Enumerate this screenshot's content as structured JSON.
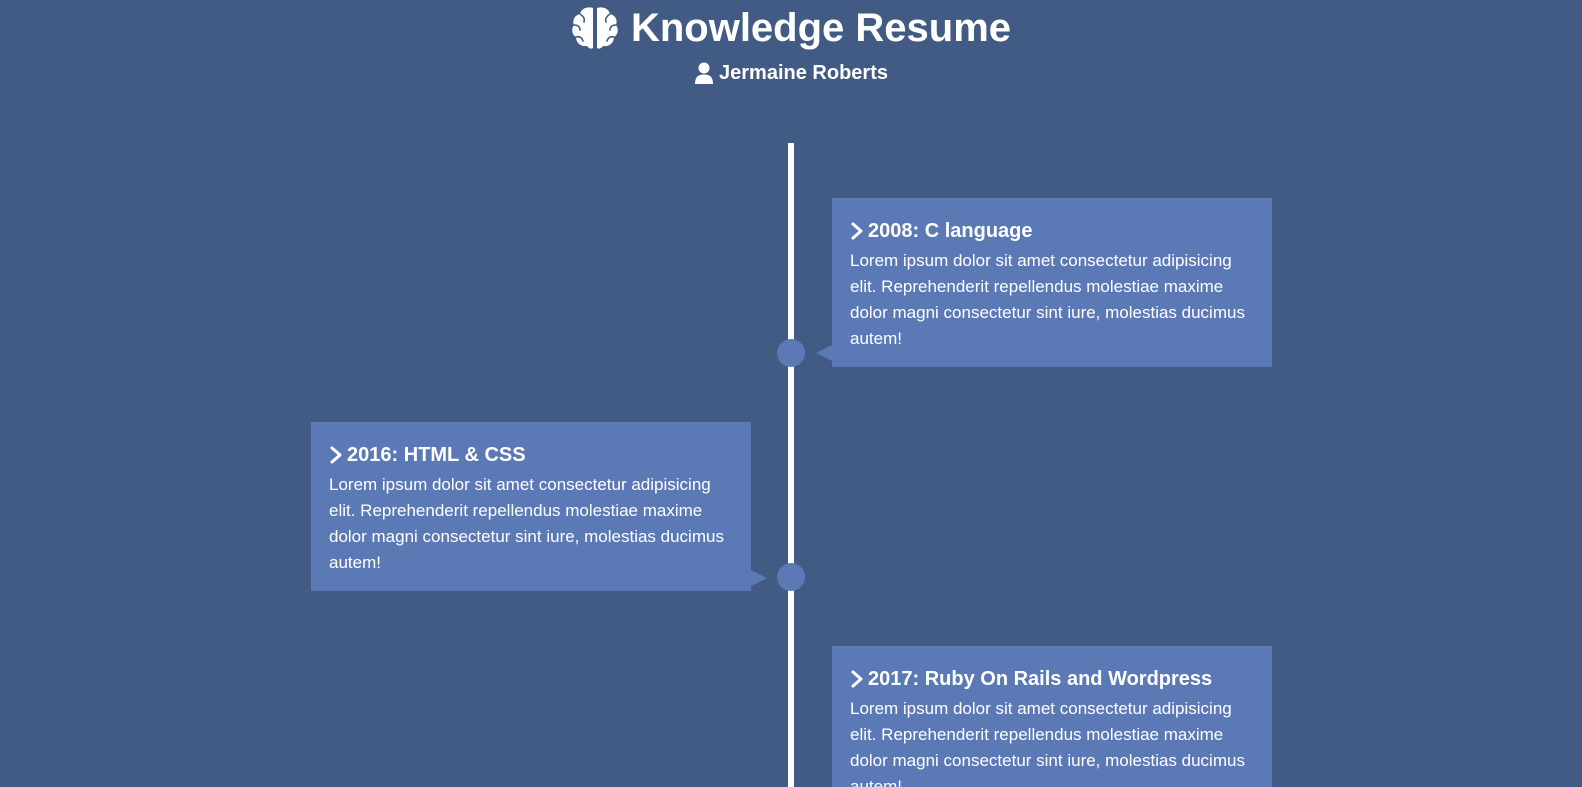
{
  "header": {
    "title": "Knowledge Resume",
    "title_icon": "brain-icon",
    "name": "Jermaine Roberts",
    "name_icon": "user-icon"
  },
  "colors": {
    "background": "#425b84",
    "card": "#5b7ab5",
    "line": "#ffffff",
    "text": "#ffffff"
  },
  "timeline": {
    "items": [
      {
        "side": "right",
        "icon": "chevron-right-icon",
        "title": "2008: C language",
        "text": "Lorem ipsum dolor sit amet consectetur adipisicing elit. Reprehenderit repellendus molestiae maxime dolor magni consectetur sint iure, molestias ducimus autem!"
      },
      {
        "side": "left",
        "icon": "chevron-right-icon",
        "title": "2016: HTML & CSS",
        "text": "Lorem ipsum dolor sit amet consectetur adipisicing elit. Reprehenderit repellendus molestiae maxime dolor magni consectetur sint iure, molestias ducimus autem!"
      },
      {
        "side": "right",
        "icon": "chevron-right-icon",
        "title": "2017: Ruby On Rails and Wordpress",
        "text": "Lorem ipsum dolor sit amet consectetur adipisicing elit. Reprehenderit repellendus molestiae maxime dolor magni consectetur sint iure, molestias ducimus autem!"
      }
    ]
  }
}
